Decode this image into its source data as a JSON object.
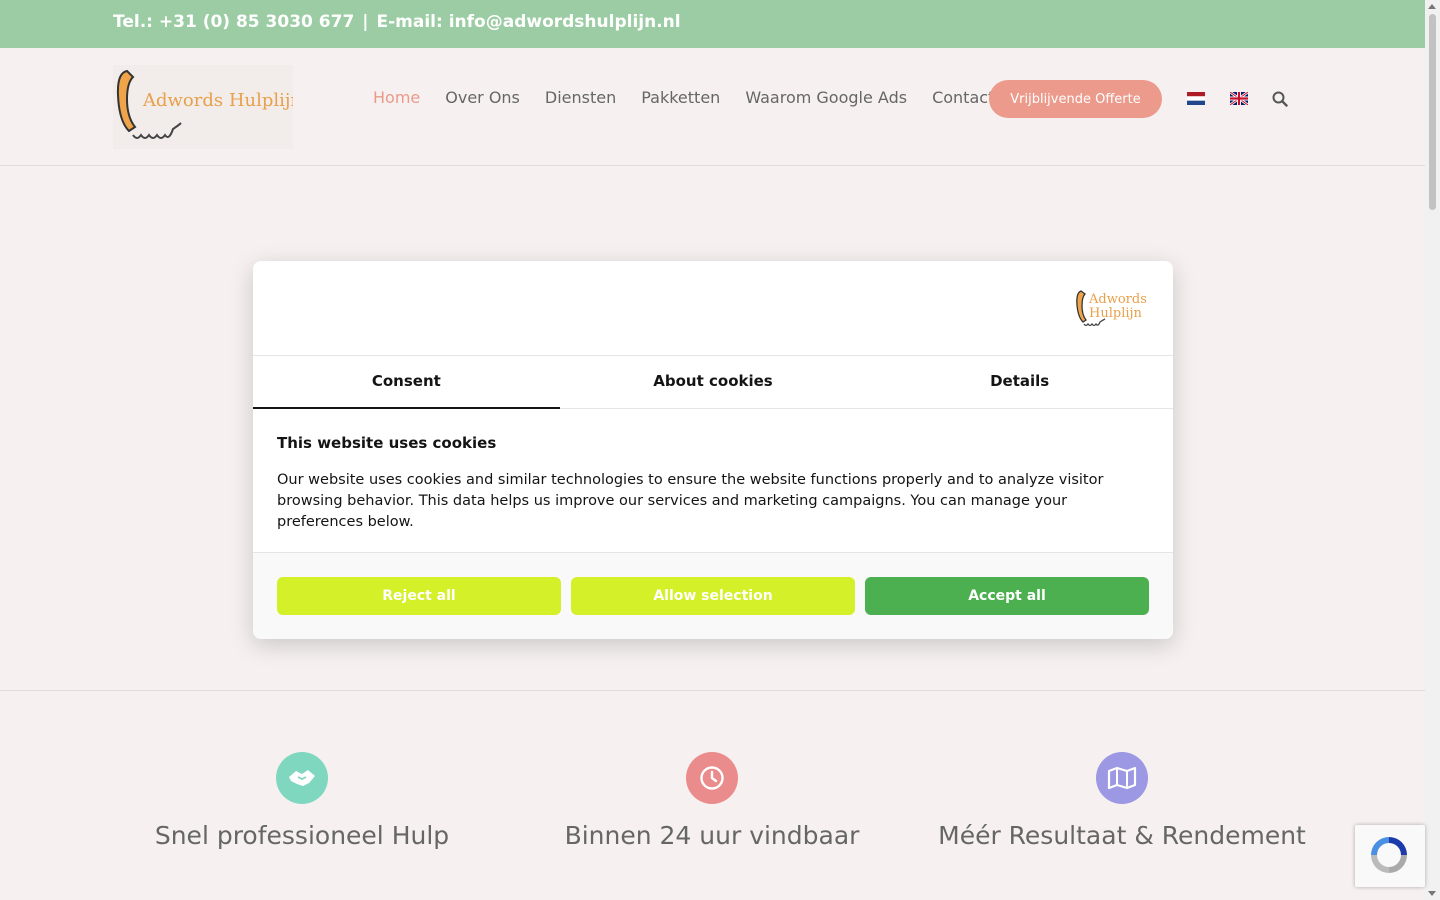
{
  "topbar": {
    "phone": "Tel.: +31 (0) 85 3030 677",
    "separator": "|",
    "email": "E-mail: info@adwordshulplijn.nl"
  },
  "header": {
    "logo_text": "Adwords Hulplijn",
    "nav": [
      {
        "label": "Home",
        "active": true
      },
      {
        "label": "Over Ons"
      },
      {
        "label": "Diensten"
      },
      {
        "label": "Pakketten"
      },
      {
        "label": "Waarom Google Ads"
      },
      {
        "label": "Contact"
      }
    ],
    "cta_label": "Vrijblijvende Offerte",
    "icons": [
      "flag-nl-icon",
      "flag-uk-icon",
      "search-icon"
    ]
  },
  "cookie_modal": {
    "brand_text_1": "Adwords",
    "brand_text_2": "Hulplijn",
    "tabs": [
      "Consent",
      "About cookies",
      "Details"
    ],
    "active_tab": "Consent",
    "title": "This website uses cookies",
    "body": "Our website uses cookies and similar technologies to ensure the website functions properly and to analyze visitor browsing behavior. This data helps us improve our services and marketing campaigns. You can manage your preferences below.",
    "buttons": {
      "reject": "Reject all",
      "allow_selection": "Allow selection",
      "accept": "Accept all"
    }
  },
  "features": [
    {
      "title": "Snel professioneel Hulp",
      "icon": "handshake-icon",
      "color": "#7fd7c0"
    },
    {
      "title": "Binnen 24 uur vindbaar",
      "icon": "clock-icon",
      "color": "#ea8b8c"
    },
    {
      "title": "Méér Resultaat & Rendement",
      "icon": "map-icon",
      "color": "#9c98e3"
    }
  ],
  "colors": {
    "topbar": "#9ccca3",
    "accent": "#ec9a8c",
    "accept_button": "#4caf50",
    "secondary_button": "#d4f029"
  }
}
